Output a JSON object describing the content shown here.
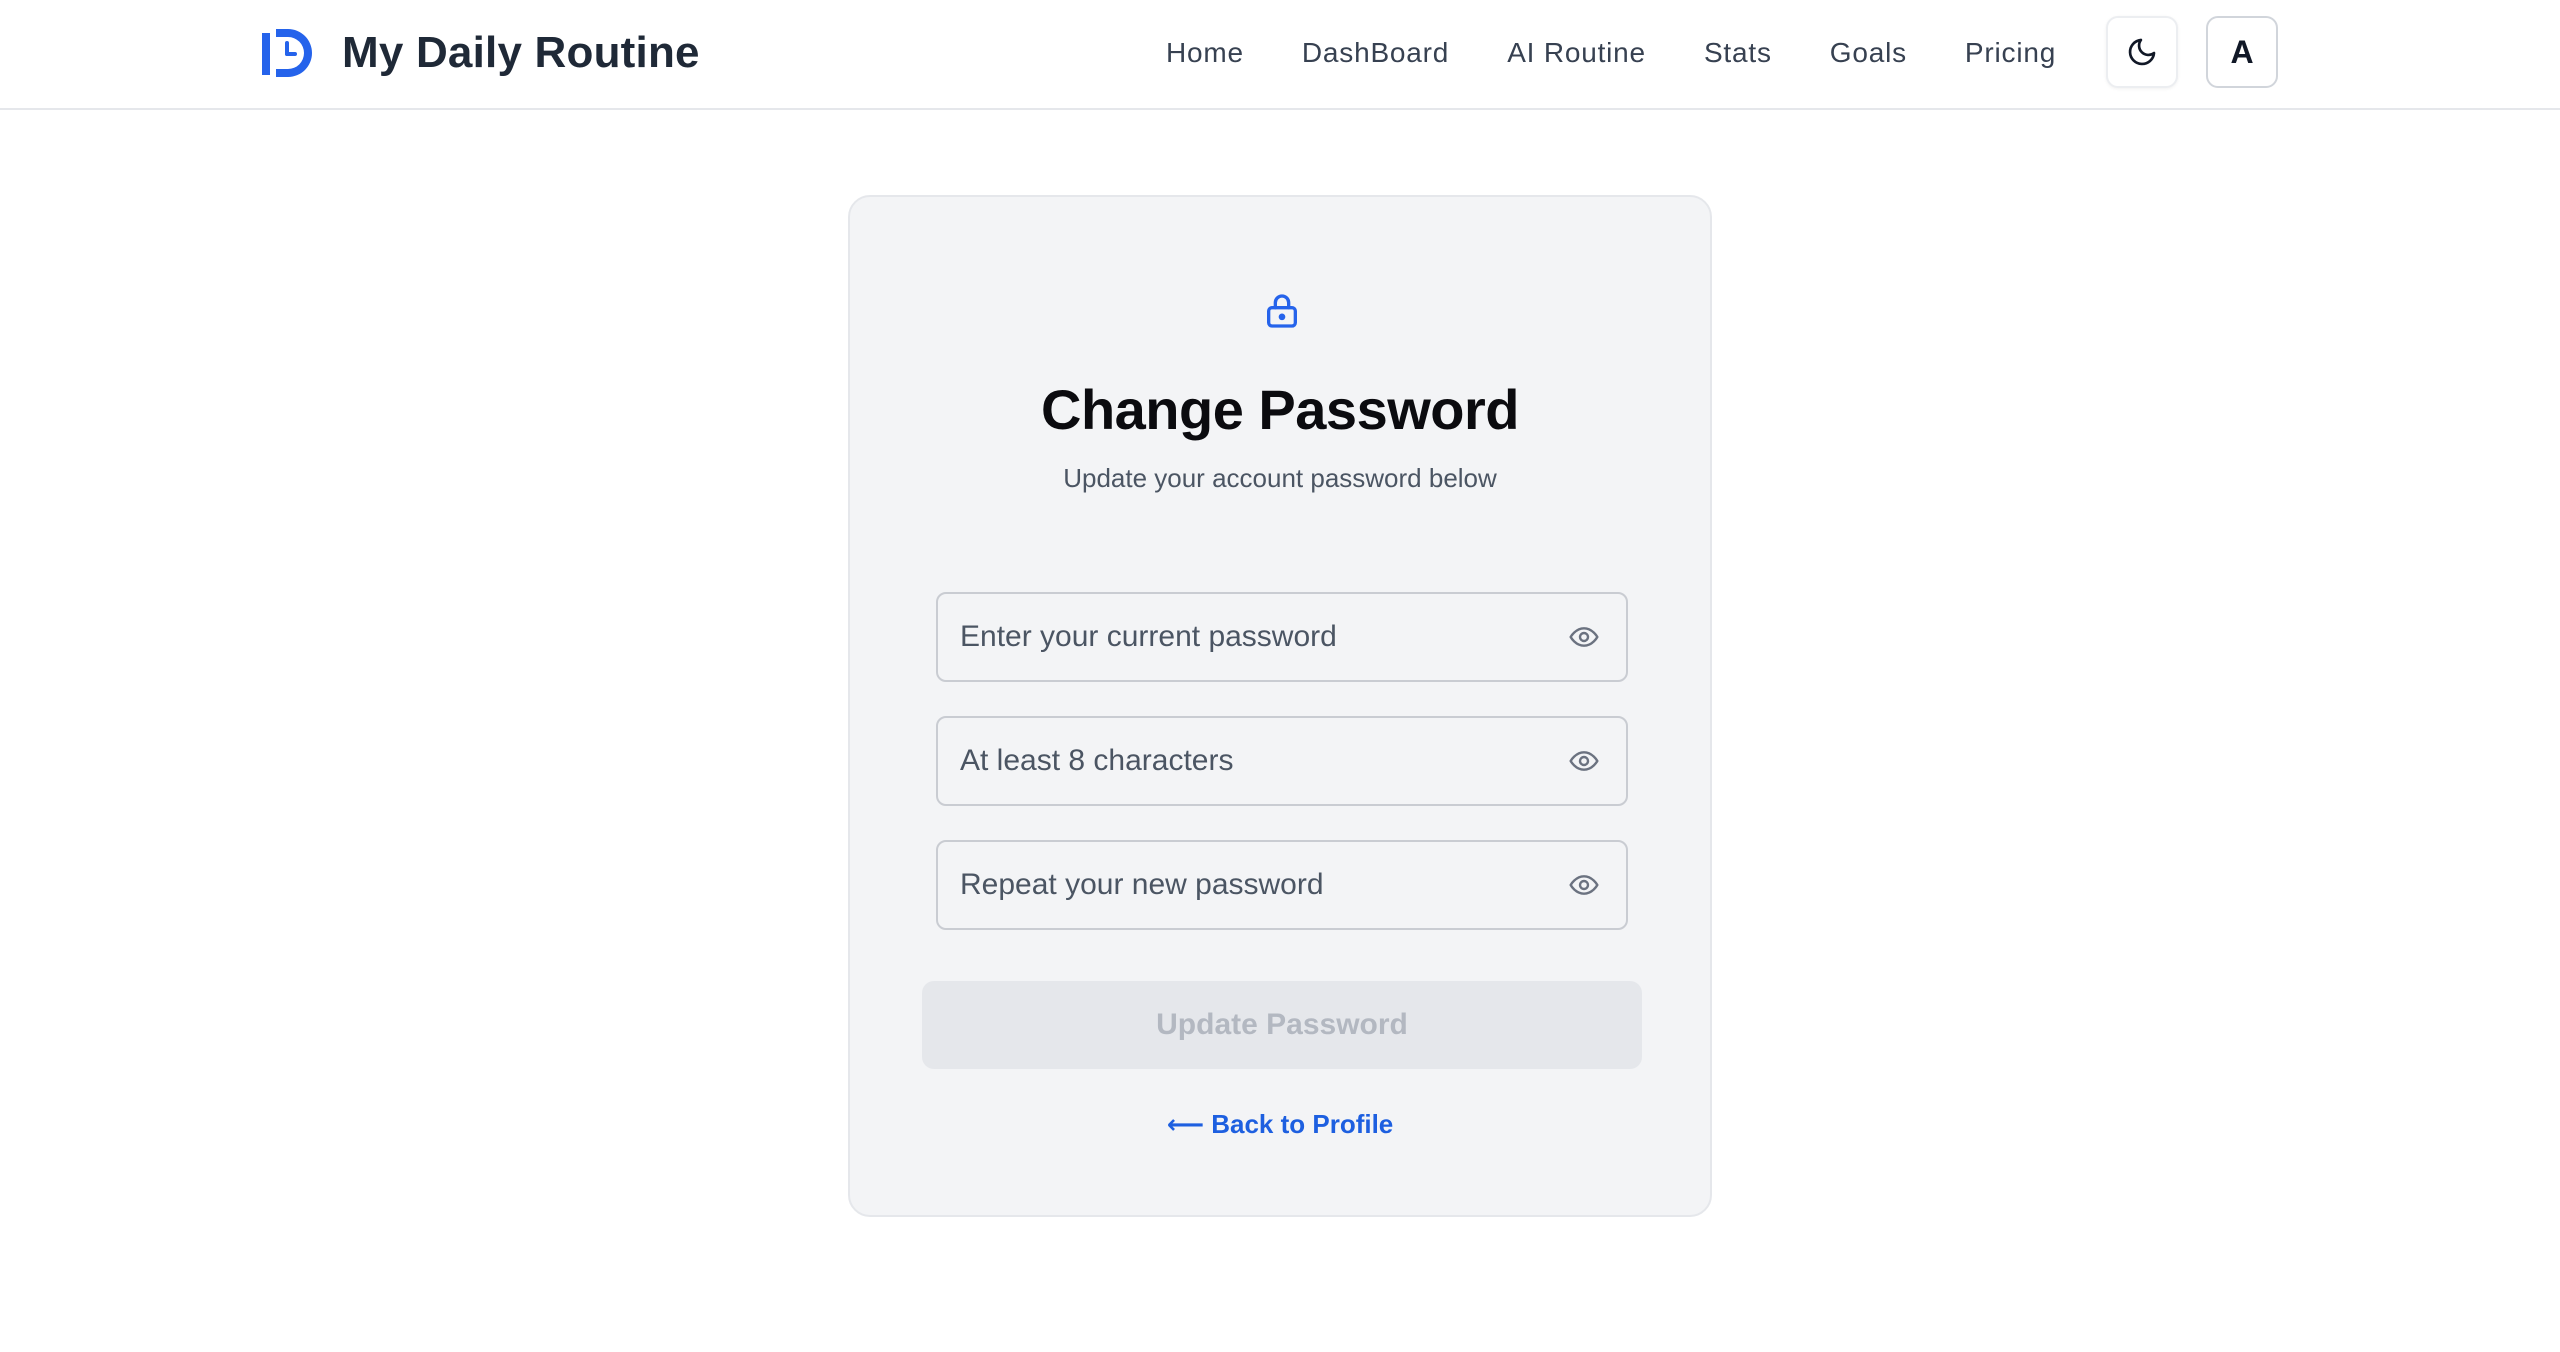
{
  "header": {
    "brand_name": "My Daily Routine",
    "logo_icon": "daily-routine-logo",
    "nav": [
      {
        "label": "Home"
      },
      {
        "label": "DashBoard"
      },
      {
        "label": "AI Routine"
      },
      {
        "label": "Stats"
      },
      {
        "label": "Goals"
      },
      {
        "label": "Pricing"
      }
    ],
    "theme_toggle_icon": "moon-icon",
    "avatar_initial": "A"
  },
  "card": {
    "icon": "lock-icon",
    "title": "Change Password",
    "subtitle": "Update your account password below",
    "fields": [
      {
        "placeholder": "Enter your current password",
        "value": "",
        "toggle_icon": "eye-icon"
      },
      {
        "placeholder": "At least 8 characters",
        "value": "",
        "toggle_icon": "eye-icon"
      },
      {
        "placeholder": "Repeat your new password",
        "value": "",
        "toggle_icon": "eye-icon"
      }
    ],
    "submit_label": "Update Password",
    "submit_disabled": true,
    "back_link": "⟵ Back to Profile"
  },
  "colors": {
    "accent": "#2563eb",
    "link": "#1d5fe0",
    "card_bg": "#f3f4f6",
    "disabled_button_bg": "#e5e7eb",
    "disabled_button_text": "#b3b8c1"
  }
}
